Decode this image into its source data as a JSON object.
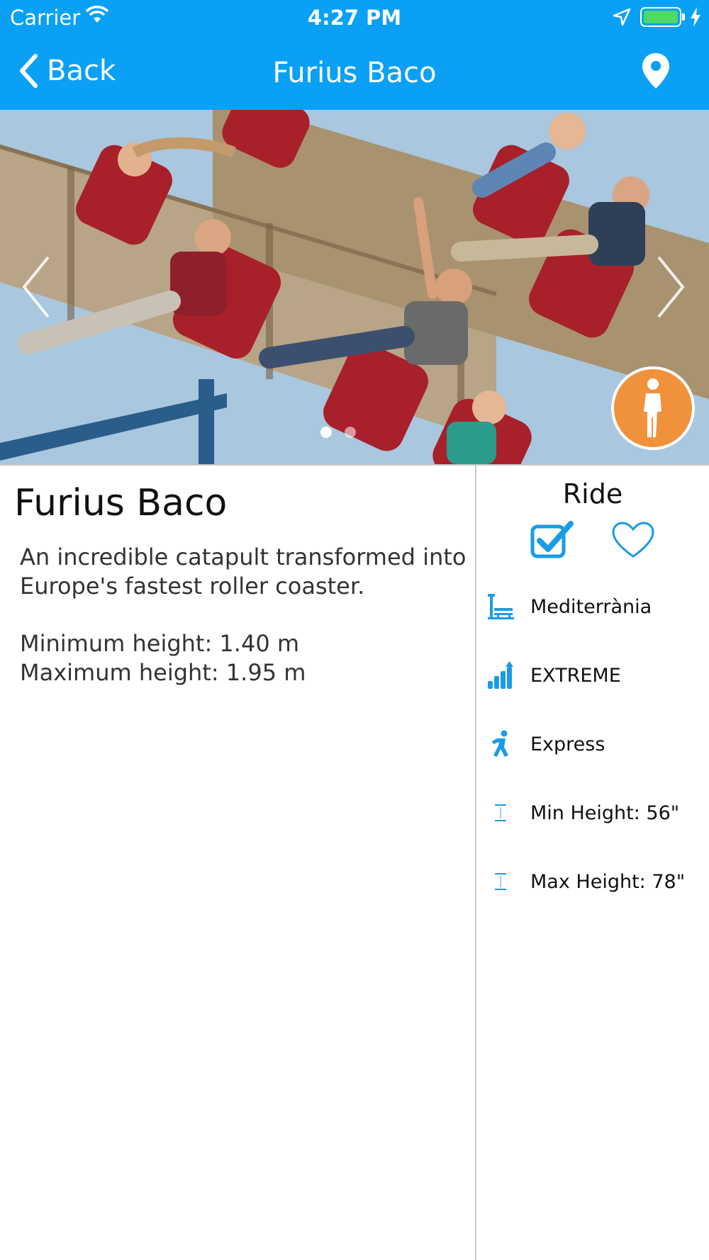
{
  "status_bar": {
    "carrier": "Carrier",
    "time": "4:27 PM",
    "battery_level": 1.0
  },
  "nav": {
    "back_label": "Back",
    "title": "Furius Baco"
  },
  "gallery": {
    "image_count": 2,
    "active_index": 0
  },
  "ride": {
    "title": "Furius Baco",
    "description_line1": "An incredible catapult transformed into",
    "description_line2": "Europe's fastest roller coaster.",
    "min_height_text": "Minimum height: 1.40 m",
    "max_height_text": "Maximum height: 1.95 m"
  },
  "side_panel": {
    "type": "Ride",
    "checked": true,
    "favorite": false,
    "info": [
      {
        "icon": "park-area-icon",
        "text": "Mediterrània"
      },
      {
        "icon": "intensity-icon",
        "text": "EXTREME"
      },
      {
        "icon": "express-icon",
        "text": "Express"
      },
      {
        "icon": "min-height-icon",
        "text": "Min Height: 56\""
      },
      {
        "icon": "max-height-icon",
        "text": "Max Height: 78\""
      }
    ]
  },
  "colors": {
    "nav_bar": "#0aa0f5",
    "accent": "#1a9be6",
    "accessibility": "#f0923b"
  }
}
